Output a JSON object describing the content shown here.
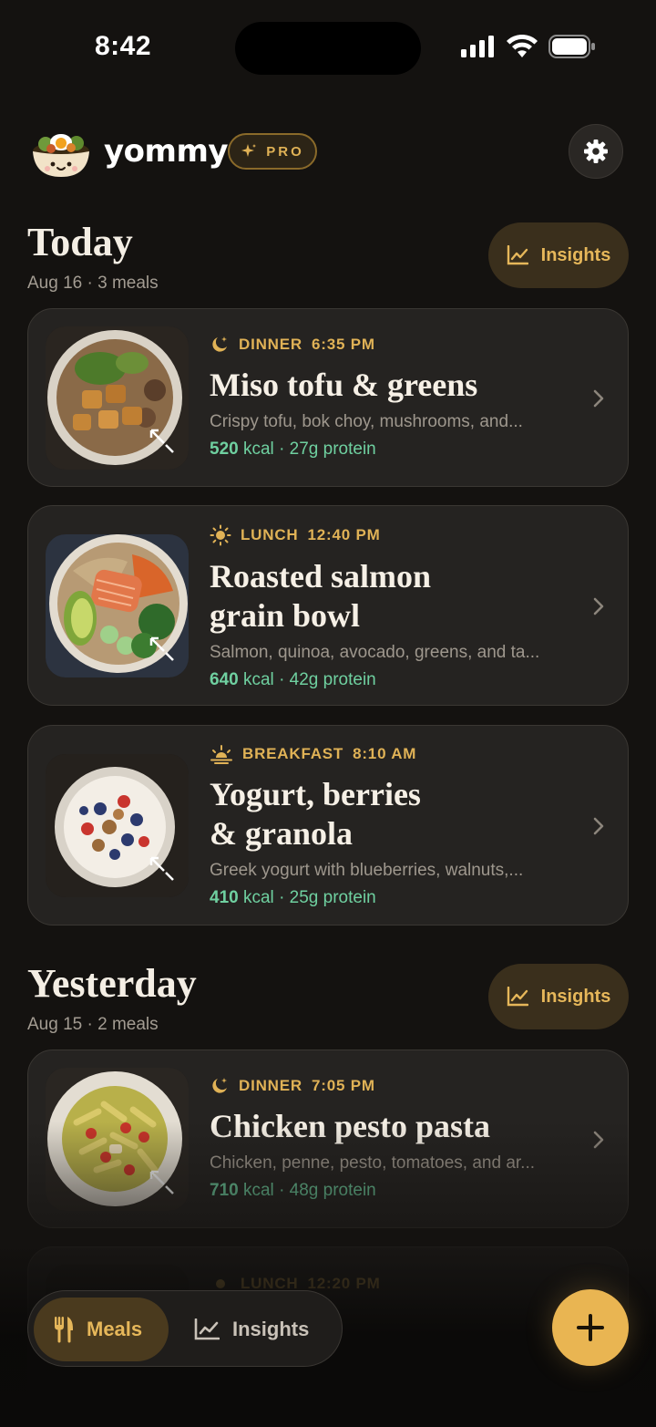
{
  "status_bar": {
    "time": "8:42"
  },
  "header": {
    "brand": "yommy",
    "pro_label": "PRO"
  },
  "sections": [
    {
      "title": "Today",
      "subtitle": "Aug 16 · 3 meals",
      "insights_label": "Insights",
      "meals": [
        {
          "meal_type": "DINNER",
          "time": "6:35 PM",
          "name": "Miso tofu & greens",
          "description": "Crispy tofu, bok choy, mushrooms, and...",
          "kcal": "520",
          "kcal_unit": "kcal",
          "protein": "· 27g protein"
        },
        {
          "meal_type": "LUNCH",
          "time": "12:40 PM",
          "name_line1": "Roasted salmon",
          "name_line2": "grain bowl",
          "description": "Salmon, quinoa, avocado, greens, and ta...",
          "kcal": "640",
          "kcal_unit": "kcal",
          "protein": "· 42g protein"
        },
        {
          "meal_type": "BREAKFAST",
          "time": "8:10 AM",
          "name_line1": "Yogurt, berries",
          "name_line2": "& granola",
          "description": "Greek yogurt with blueberries, walnuts,...",
          "kcal": "410",
          "kcal_unit": "kcal",
          "protein": "· 25g protein"
        }
      ]
    },
    {
      "title": "Yesterday",
      "subtitle": "Aug 15 · 2 meals",
      "insights_label": "Insights",
      "meals": [
        {
          "meal_type": "DINNER",
          "time": "7:05 PM",
          "name": "Chicken pesto pasta",
          "description": "Chicken, penne, pesto, tomatoes, and ar...",
          "kcal": "710",
          "kcal_unit": "kcal",
          "protein": "· 48g protein"
        },
        {
          "meal_type": "LUNCH",
          "time": "12:20 PM"
        }
      ]
    }
  ],
  "bottom_nav": {
    "meals_label": "Meals",
    "insights_label": "Insights"
  },
  "colors": {
    "accent": "#e6b75a",
    "kcal": "#6fd0a0",
    "background": "#141210",
    "card": "#252321"
  }
}
